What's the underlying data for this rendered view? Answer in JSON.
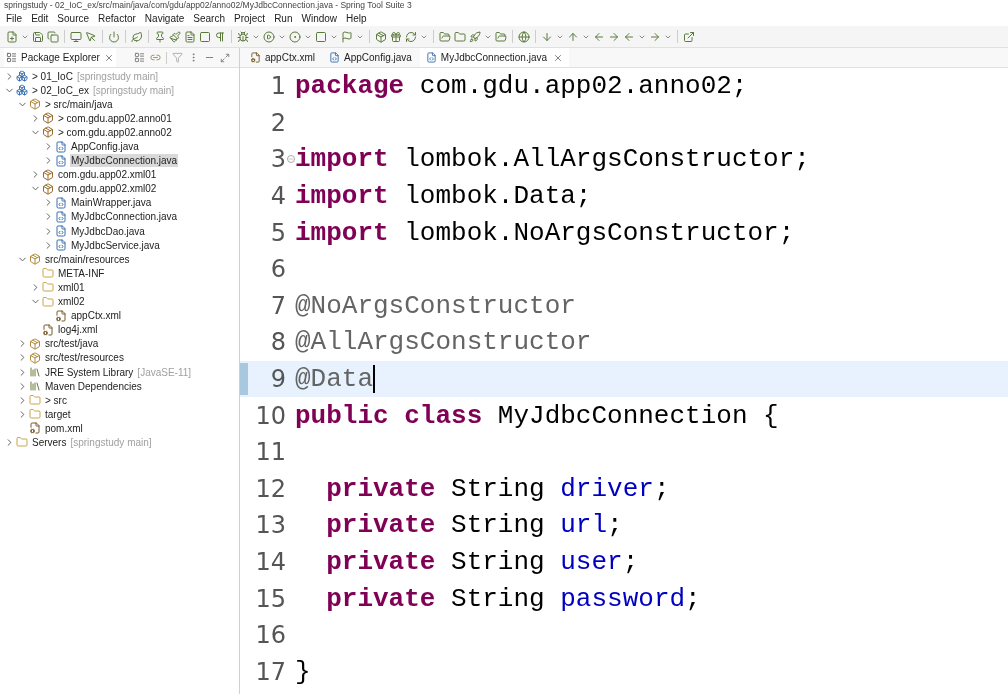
{
  "window": {
    "title": "springstudy - 02_IoC_ex/src/main/java/com/gdu/app02/anno02/MyJdbcConnection.java - Spring Tool Suite 3"
  },
  "menu": [
    "File",
    "Edit",
    "Source",
    "Refactor",
    "Navigate",
    "Search",
    "Project",
    "Run",
    "Window",
    "Help"
  ],
  "explorer": {
    "title": "Package Explorer",
    "tree": [
      {
        "label": "> 01_IoC",
        "decoration": "[springstudy main]",
        "kind": "project",
        "expanded": false,
        "selected": false
      },
      {
        "label": "> 02_IoC_ex",
        "decoration": "[springstudy main]",
        "kind": "project",
        "expanded": true,
        "selected": false,
        "children": [
          {
            "label": "> src/main/java",
            "kind": "source-folder",
            "expanded": true,
            "selected": false,
            "children": [
              {
                "label": "> com.gdu.app02.anno01",
                "kind": "package",
                "expanded": false,
                "selected": false
              },
              {
                "label": "> com.gdu.app02.anno02",
                "kind": "package",
                "expanded": true,
                "selected": false,
                "children": [
                  {
                    "label": "AppConfig.java",
                    "kind": "java-file",
                    "expanded": false,
                    "selected": false
                  },
                  {
                    "label": "MyJdbcConnection.java",
                    "kind": "java-file",
                    "expanded": false,
                    "selected": true
                  }
                ]
              },
              {
                "label": "com.gdu.app02.xml01",
                "kind": "package",
                "expanded": false,
                "selected": false
              },
              {
                "label": "com.gdu.app02.xml02",
                "kind": "package",
                "expanded": true,
                "selected": false,
                "children": [
                  {
                    "label": "MainWrapper.java",
                    "kind": "java-file",
                    "expanded": false,
                    "selected": false
                  },
                  {
                    "label": "MyJdbcConnection.java",
                    "kind": "java-file",
                    "expanded": false,
                    "selected": false
                  },
                  {
                    "label": "MyJdbcDao.java",
                    "kind": "java-file",
                    "expanded": false,
                    "selected": false
                  },
                  {
                    "label": "MyJdbcService.java",
                    "kind": "java-file",
                    "expanded": false,
                    "selected": false
                  }
                ]
              }
            ]
          },
          {
            "label": "src/main/resources",
            "kind": "source-folder",
            "expanded": true,
            "selected": false,
            "children": [
              {
                "label": "META-INF",
                "kind": "folder",
                "selected": false
              },
              {
                "label": "xml01",
                "kind": "folder",
                "expanded": false,
                "selected": false
              },
              {
                "label": "xml02",
                "kind": "folder",
                "expanded": true,
                "selected": false,
                "children": [
                  {
                    "label": "appCtx.xml",
                    "kind": "xml-file",
                    "selected": false
                  }
                ]
              },
              {
                "label": "log4j.xml",
                "kind": "xml-file",
                "selected": false
              }
            ]
          },
          {
            "label": "src/test/java",
            "kind": "source-folder",
            "expanded": false,
            "selected": false
          },
          {
            "label": "src/test/resources",
            "kind": "source-folder",
            "expanded": false,
            "selected": false
          },
          {
            "label": "JRE System Library",
            "decoration": "[JavaSE-11]",
            "kind": "library",
            "expanded": false,
            "selected": false
          },
          {
            "label": "Maven Dependencies",
            "kind": "library",
            "expanded": false,
            "selected": false
          },
          {
            "label": "> src",
            "kind": "folder",
            "expanded": false,
            "selected": false
          },
          {
            "label": "target",
            "kind": "folder",
            "expanded": false,
            "selected": false
          },
          {
            "label": "pom.xml",
            "kind": "xml-file",
            "selected": false
          }
        ]
      },
      {
        "label": "Servers",
        "decoration": "[springstudy main]",
        "kind": "folder",
        "expanded": false,
        "selected": false
      }
    ]
  },
  "editor_tabs": [
    {
      "label": "appCtx.xml",
      "kind": "xml-file",
      "selected": false
    },
    {
      "label": "AppConfig.java",
      "kind": "java-file",
      "selected": false
    },
    {
      "label": "MyJdbcConnection.java",
      "kind": "java-file",
      "selected": true
    }
  ],
  "code": [
    {
      "number": "1",
      "current": false,
      "fold_toggle": false,
      "tokens": [
        {
          "text": "package",
          "kind": "keyword"
        },
        {
          "text": " com.gdu.app02.anno02;",
          "kind": "plain"
        }
      ]
    },
    {
      "number": "2",
      "current": false,
      "fold_toggle": false
    },
    {
      "number": "3",
      "current": false,
      "fold_toggle": true,
      "tokens": [
        {
          "text": "import",
          "kind": "keyword"
        },
        {
          "text": " lombok.AllArgsConstructor;",
          "kind": "plain"
        }
      ]
    },
    {
      "number": "4",
      "current": false,
      "fold_toggle": false,
      "tokens": [
        {
          "text": "import",
          "kind": "keyword"
        },
        {
          "text": " lombok.Data;",
          "kind": "plain"
        }
      ]
    },
    {
      "number": "5",
      "current": false,
      "fold_toggle": false,
      "tokens": [
        {
          "text": "import",
          "kind": "keyword"
        },
        {
          "text": " lombok.NoArgsConstructor;",
          "kind": "plain"
        }
      ]
    },
    {
      "number": "6",
      "current": false,
      "fold_toggle": false
    },
    {
      "number": "7",
      "current": false,
      "fold_toggle": false,
      "tokens": [
        {
          "text": "@NoArgsConstructor",
          "kind": "annotation"
        }
      ]
    },
    {
      "number": "8",
      "current": false,
      "fold_toggle": false,
      "tokens": [
        {
          "text": "@AllArgsConstructor",
          "kind": "annotation"
        }
      ]
    },
    {
      "number": "9",
      "current": true,
      "fold_toggle": false,
      "tokens": [
        {
          "text": "@Data",
          "kind": "annotation"
        }
      ]
    },
    {
      "number": "10",
      "current": false,
      "fold_toggle": false,
      "tokens": [
        {
          "text": "public class",
          "kind": "keyword"
        },
        {
          "text": " MyJdbcConnection {",
          "kind": "plain"
        }
      ]
    },
    {
      "number": "11",
      "current": false,
      "fold_toggle": false
    },
    {
      "number": "12",
      "current": false,
      "fold_toggle": false,
      "tokens": [
        {
          "text": "  private",
          "kind": "keyword"
        },
        {
          "text": " String ",
          "kind": "plain"
        },
        {
          "text": "driver",
          "kind": "field"
        },
        {
          "text": ";",
          "kind": "plain"
        }
      ]
    },
    {
      "number": "13",
      "current": false,
      "fold_toggle": false,
      "tokens": [
        {
          "text": "  private",
          "kind": "keyword"
        },
        {
          "text": " String ",
          "kind": "plain"
        },
        {
          "text": "url",
          "kind": "field"
        },
        {
          "text": ";",
          "kind": "plain"
        }
      ]
    },
    {
      "number": "14",
      "current": false,
      "fold_toggle": false,
      "tokens": [
        {
          "text": "  private",
          "kind": "keyword"
        },
        {
          "text": " String ",
          "kind": "plain"
        },
        {
          "text": "user",
          "kind": "field"
        },
        {
          "text": ";",
          "kind": "plain"
        }
      ]
    },
    {
      "number": "15",
      "current": false,
      "fold_toggle": false,
      "tokens": [
        {
          "text": "  private",
          "kind": "keyword"
        },
        {
          "text": " String ",
          "kind": "plain"
        },
        {
          "text": "password",
          "kind": "field"
        },
        {
          "text": ";",
          "kind": "plain"
        }
      ]
    },
    {
      "number": "16",
      "current": false,
      "fold_toggle": false
    },
    {
      "number": "17",
      "current": false,
      "fold_toggle": false,
      "tokens": [
        {
          "text": "}",
          "kind": "plain"
        }
      ]
    }
  ]
}
